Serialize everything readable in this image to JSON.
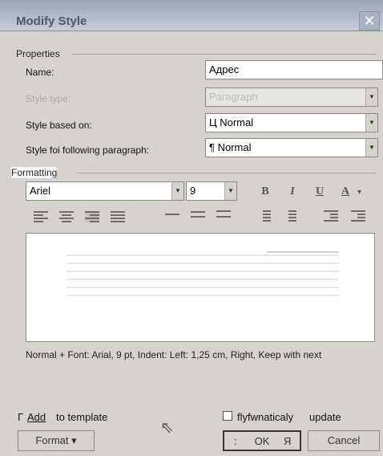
{
  "window": {
    "title": "Modify Style",
    "close_symbol": "✕"
  },
  "properties": {
    "section_label": "Properties",
    "name_label": "Name:",
    "name_value": "Адрес",
    "style_type_label": "Style type:",
    "style_type_value": "Paragraph",
    "based_on_label": "Style based on:",
    "based_on_value": "Ц Normal",
    "following_label": "Style foi following paragraph:",
    "following_value": "¶ Normal"
  },
  "formatting": {
    "section_label": "Formatting",
    "font_name": "Ariel",
    "font_size": "9",
    "bold": "B",
    "italic": "I",
    "underline": "U",
    "font_color": "A"
  },
  "description": "Normal + Font: Arial, 9 pt, Indent: Left:  1,25 cm, Right, Keep with next",
  "footer": {
    "add_prefix": "Г",
    "add_label": "Add",
    "to_template_label": "to template",
    "auto_update_label": "flyfwnaticaly",
    "update_label": "update",
    "format_button": "Format ▾",
    "ok_button_prefix": ":",
    "ok_button": "OK",
    "ok_button_suffix": "Я",
    "cancel_button": "Cancel"
  }
}
